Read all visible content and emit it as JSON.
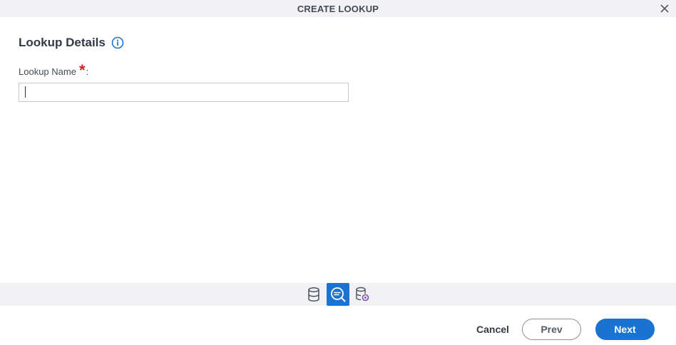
{
  "dialog": {
    "title": "CREATE LOOKUP"
  },
  "section": {
    "title": "Lookup Details",
    "info_icon": "info-icon"
  },
  "field": {
    "label": "Lookup Name",
    "required_mark": "*",
    "colon": ":",
    "value": "",
    "placeholder": ""
  },
  "steps": [
    {
      "icon": "database-icon",
      "active": false
    },
    {
      "icon": "lookup-search-icon",
      "active": true
    },
    {
      "icon": "database-settings-icon",
      "active": false
    }
  ],
  "footer": {
    "cancel_label": "Cancel",
    "prev_label": "Prev",
    "next_label": "Next"
  },
  "colors": {
    "accent": "#1a73d1",
    "required": "#c62828",
    "titlebar_bg": "#f2f2f5"
  }
}
